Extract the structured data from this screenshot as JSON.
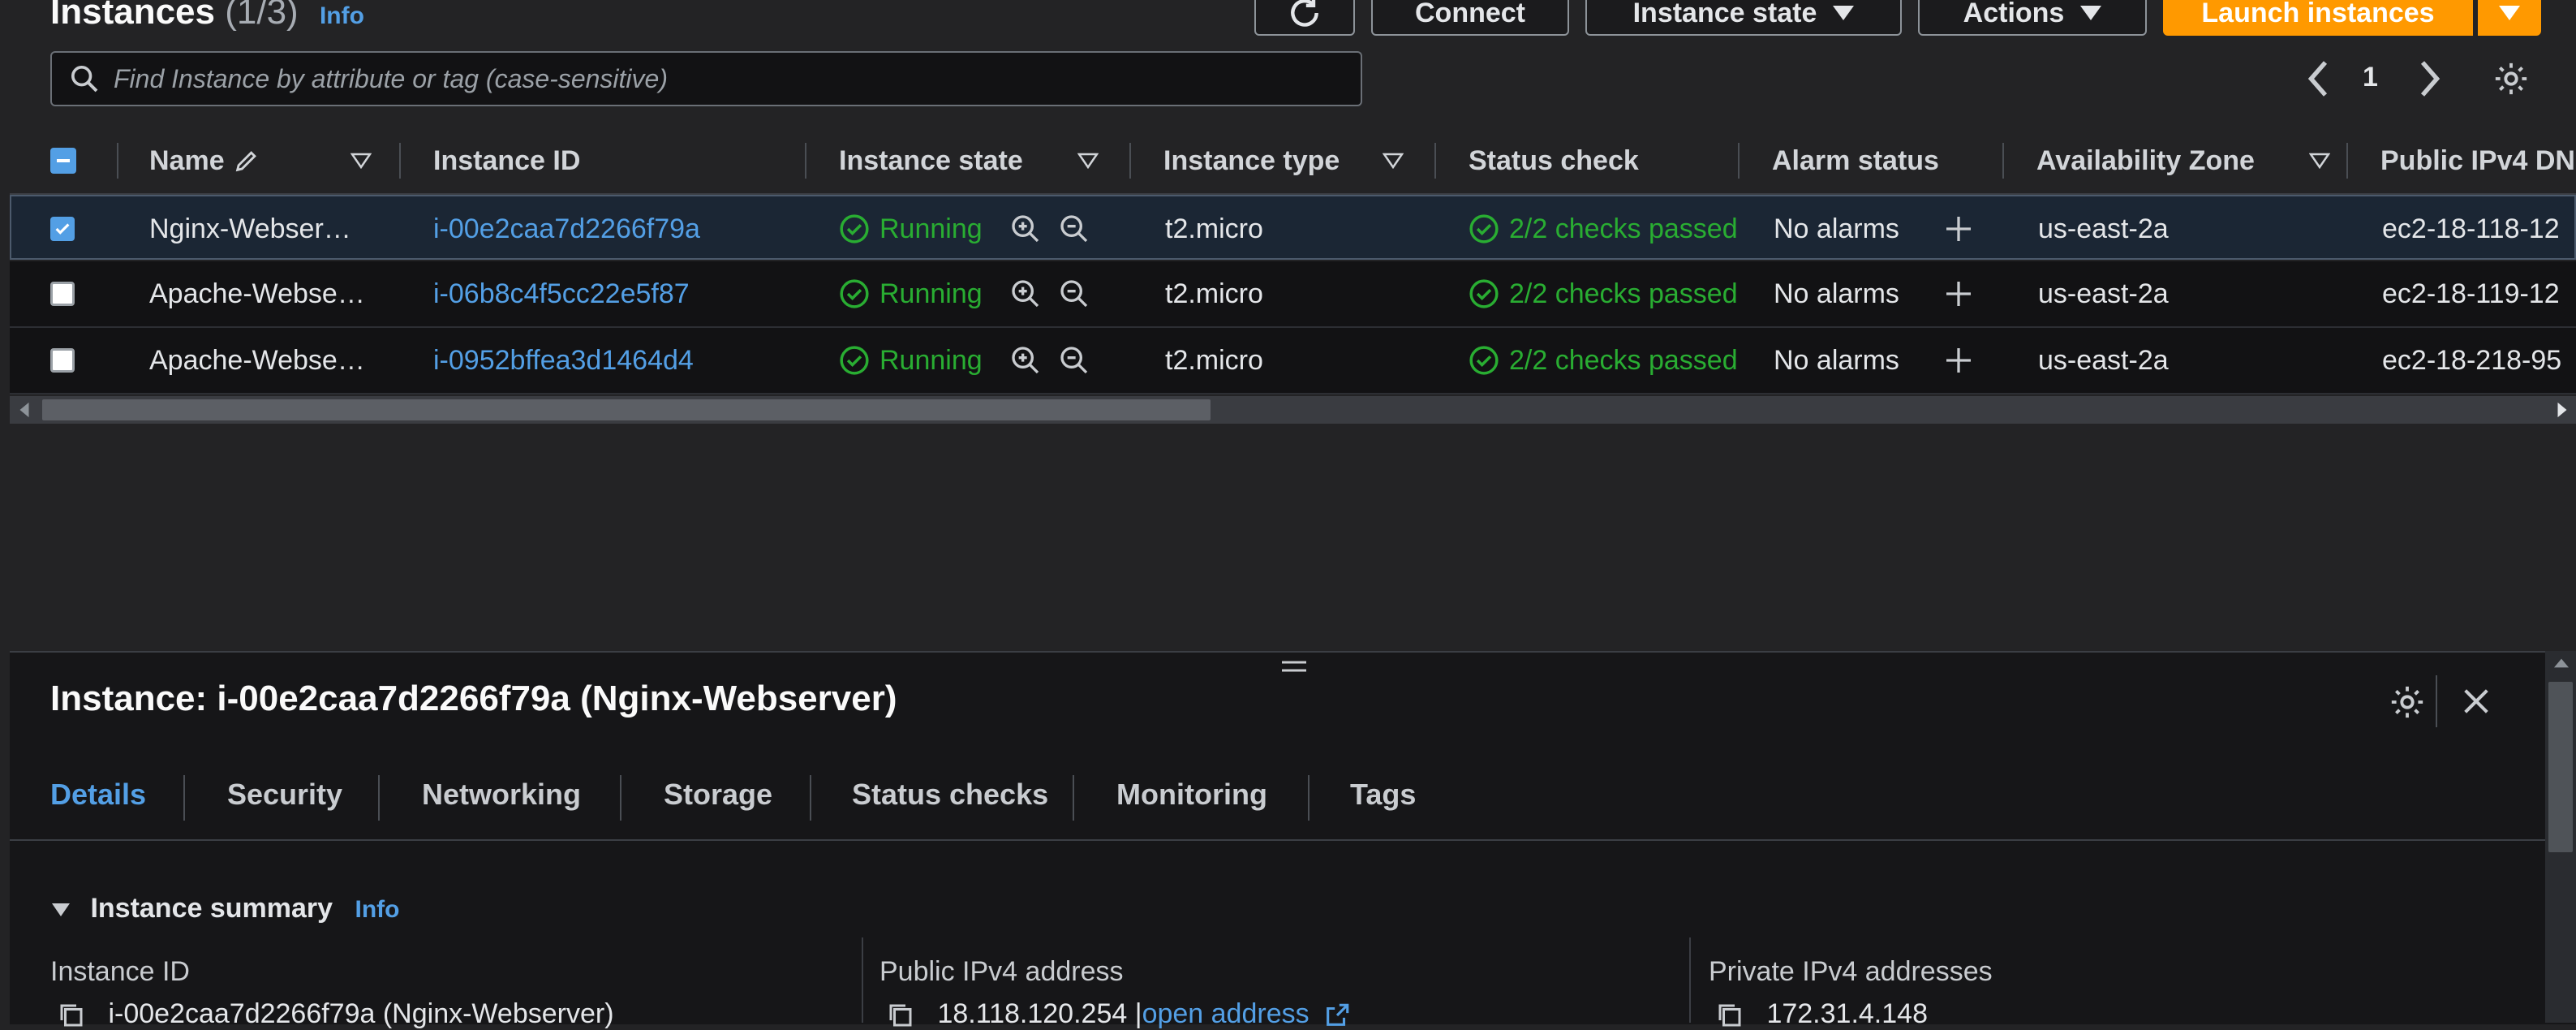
{
  "header": {
    "title": "Instances",
    "count": "(1/3)",
    "info": "Info",
    "buttons": {
      "connect": "Connect",
      "instance_state": "Instance state",
      "actions": "Actions",
      "launch": "Launch instances"
    }
  },
  "search": {
    "placeholder": "Find Instance by attribute or tag (case-sensitive)",
    "page": "1"
  },
  "table": {
    "columns": [
      "Name",
      "Instance ID",
      "Instance state",
      "Instance type",
      "Status check",
      "Alarm status",
      "Availability Zone",
      "Public IPv4 DN"
    ],
    "rows": [
      {
        "name": "Nginx-Webser…",
        "id": "i-00e2caa7d2266f79a",
        "state": "Running",
        "type": "t2.micro",
        "status": "2/2 checks passed",
        "alarm": "No alarms",
        "az": "us-east-2a",
        "dns": "ec2-18-118-12",
        "selected": true
      },
      {
        "name": "Apache-Webse…",
        "id": "i-06b8c4f5cc22e5f87",
        "state": "Running",
        "type": "t2.micro",
        "status": "2/2 checks passed",
        "alarm": "No alarms",
        "az": "us-east-2a",
        "dns": "ec2-18-119-12",
        "selected": false
      },
      {
        "name": "Apache-Webse…",
        "id": "i-0952bffea3d1464d4",
        "state": "Running",
        "type": "t2.micro",
        "status": "2/2 checks passed",
        "alarm": "No alarms",
        "az": "us-east-2a",
        "dns": "ec2-18-218-95",
        "selected": false
      }
    ]
  },
  "detail": {
    "title": "Instance: i-00e2caa7d2266f79a (Nginx-Webserver)",
    "tabs": [
      "Details",
      "Security",
      "Networking",
      "Storage",
      "Status checks",
      "Monitoring",
      "Tags"
    ],
    "summary": "Instance summary",
    "summary_info": "Info",
    "fields": [
      {
        "label": "Instance ID",
        "value": "i-00e2caa7d2266f79a (Nginx-Webserver)"
      },
      {
        "label": "Public IPv4 address",
        "value": "18.118.120.254 |",
        "link": "open address"
      },
      {
        "label": "Private IPv4 addresses",
        "value": "172.31.4.148"
      }
    ]
  },
  "colors": {
    "accent": "#539fe5",
    "primary": "#ff9900",
    "success": "#29ad32"
  }
}
